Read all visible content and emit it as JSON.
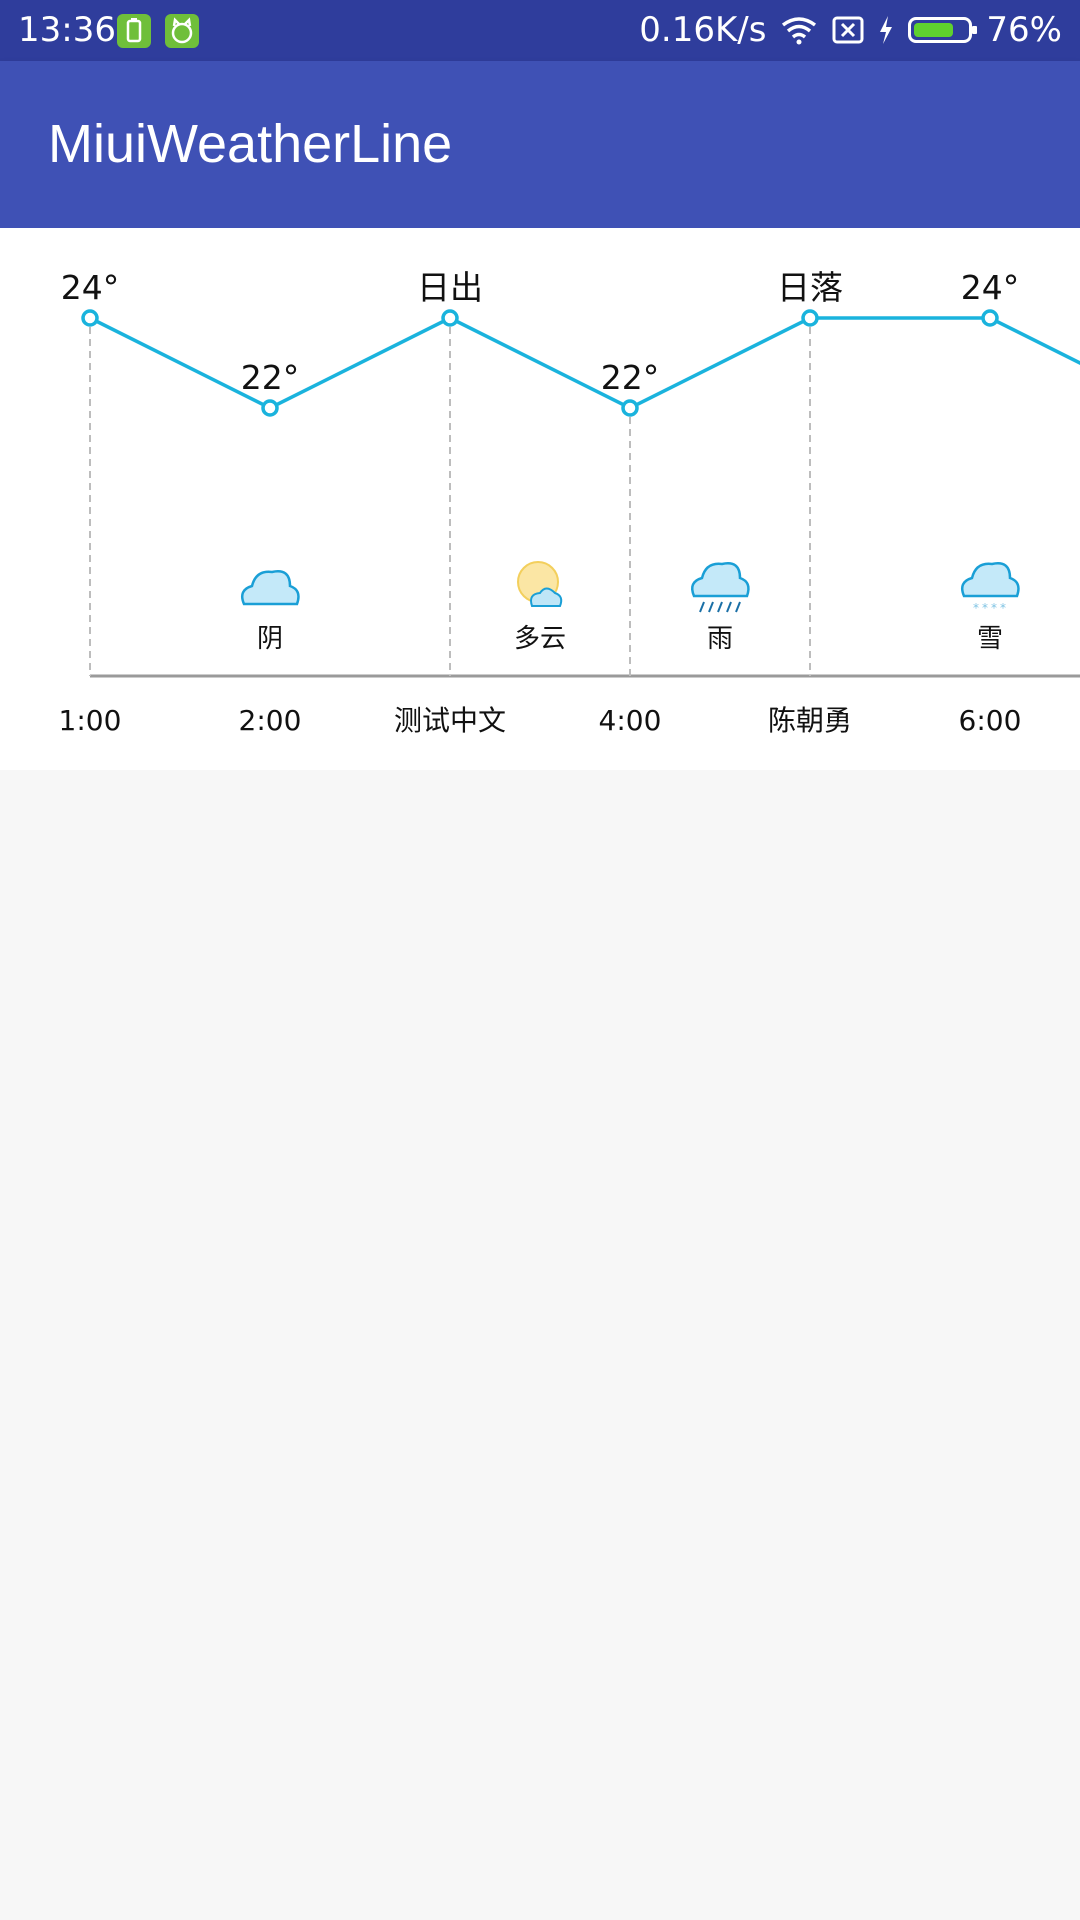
{
  "status_bar": {
    "time": "13:36",
    "net_speed": "0.16K/s",
    "battery": "76%",
    "battery_level": 0.76,
    "icons": [
      "battery-app-icon",
      "android-cat-icon",
      "wifi-icon",
      "no-sim-icon",
      "charging-icon",
      "battery-icon"
    ]
  },
  "app_bar": {
    "title": "MiuiWeatherLine",
    "color": "#3f51b5"
  },
  "chart_data": {
    "type": "line",
    "line_color": "#1ab3dd",
    "points": [
      {
        "time": "1:00",
        "temp": 24,
        "label": "24°"
      },
      {
        "time": "2:00",
        "temp": 22,
        "label": "22°"
      },
      {
        "time": "测试中文",
        "temp": 24,
        "label": "日出"
      },
      {
        "time": "4:00",
        "temp": 22,
        "label": "22°"
      },
      {
        "time": "陈朝勇",
        "temp": 24,
        "label": "日落"
      },
      {
        "time": "6:00",
        "temp": 24,
        "label": "24°"
      },
      {
        "time": "",
        "temp": 22,
        "label": ""
      }
    ],
    "weather_segments": [
      {
        "start": 0,
        "end": 2,
        "condition": "阴",
        "icon": "cloud-icon"
      },
      {
        "start": 2,
        "end": 3,
        "condition": "多云",
        "icon": "partly-cloudy-icon"
      },
      {
        "start": 3,
        "end": 4,
        "condition": "雨",
        "icon": "rain-cloud-icon"
      },
      {
        "start": 4,
        "end": 6,
        "condition": "雪",
        "icon": "snow-cloud-icon"
      }
    ]
  }
}
